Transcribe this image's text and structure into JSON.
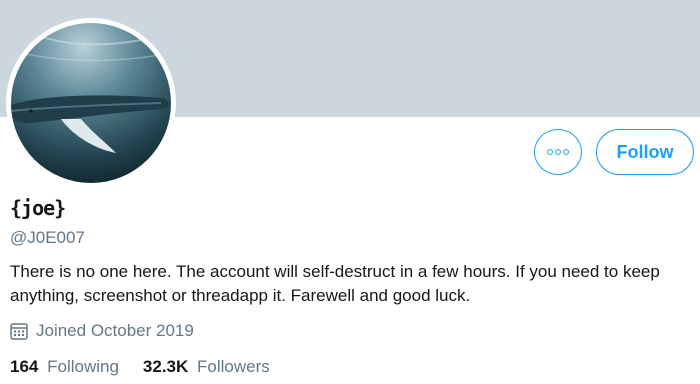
{
  "profile": {
    "display_name": "{joe}",
    "handle": "@J0E007",
    "bio": "There is no one here. The account will self-destruct in a few hours. If you need to keep anything, screenshot or threadapp it. Farewell and good luck.",
    "joined": "Joined October 2019"
  },
  "actions": {
    "more_icon": "more-dots-icon",
    "follow_label": "Follow"
  },
  "stats": {
    "following_count": "164",
    "following_label": "Following",
    "followers_count": "32.3K",
    "followers_label": "Followers"
  },
  "colors": {
    "accent": "#1da1f2",
    "banner": "#ccd6dd",
    "secondary_text": "#657786"
  }
}
